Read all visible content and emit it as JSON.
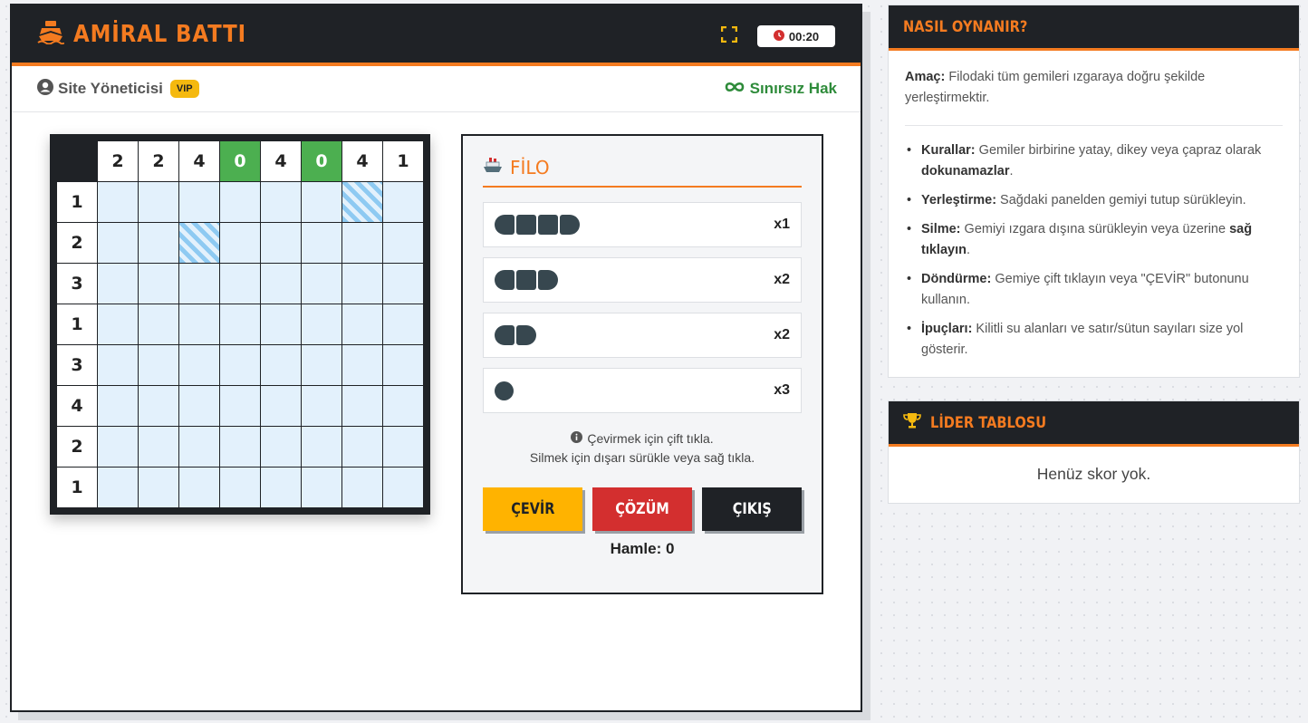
{
  "header": {
    "title": "AMİRAL BATTI",
    "timer": "00:20"
  },
  "user": {
    "name": "Site Yöneticisi",
    "badge": "VIP",
    "rights": "Sınırsız Hak"
  },
  "board": {
    "col_clues": [
      "2",
      "2",
      "4",
      "0",
      "4",
      "0",
      "4",
      "1"
    ],
    "col_done": [
      false,
      false,
      false,
      true,
      false,
      true,
      false,
      false
    ],
    "row_clues": [
      "1",
      "2",
      "3",
      "1",
      "3",
      "4",
      "2",
      "1"
    ],
    "locked_water": [
      [
        0,
        6
      ],
      [
        1,
        2
      ]
    ]
  },
  "fleet": {
    "title": "FİLO",
    "ships": [
      {
        "size": 4,
        "count": "x1"
      },
      {
        "size": 3,
        "count": "x2"
      },
      {
        "size": 2,
        "count": "x2"
      },
      {
        "size": 1,
        "count": "x3"
      }
    ],
    "hint_line1": "Çevirmek için çift tıkla.",
    "hint_line2": "Silmek için dışarı sürükle veya sağ tıkla.",
    "rotate_label": "ÇEVİR",
    "solve_label": "ÇÖZÜM",
    "exit_label": "ÇIKIŞ",
    "moves": "Hamle: 0"
  },
  "howto": {
    "title": "NASIL OYNANIR?",
    "goal_label": "Amaç:",
    "goal_text": " Filodaki tüm gemileri ızgaraya doğru şekilde yerleştirmektir.",
    "rules": [
      {
        "label": "Kurallar:",
        "text": " Gemiler birbirine yatay, dikey veya çapraz olarak ",
        "bold_tail": "dokunamazlar",
        "tail": "."
      },
      {
        "label": "Yerleştirme:",
        "text": " Sağdaki panelden gemiyi tutup sürükleyin.",
        "bold_tail": "",
        "tail": ""
      },
      {
        "label": "Silme:",
        "text": " Gemiyi ızgara dışına sürükleyin veya üzerine ",
        "bold_tail": "sağ tıklayın",
        "tail": "."
      },
      {
        "label": "Döndürme:",
        "text": " Gemiye çift tıklayın veya \"ÇEVİR\" butonunu kullanın.",
        "bold_tail": "",
        "tail": ""
      },
      {
        "label": "İpuçları:",
        "text": " Kilitli su alanları ve satır/sütun sayıları size yol gösterir.",
        "bold_tail": "",
        "tail": ""
      }
    ]
  },
  "leaderboard": {
    "title": "LİDER TABLOSU",
    "empty": "Henüz skor yok."
  },
  "colors": {
    "accent": "#f47b20",
    "dark": "#1f2226",
    "water": "#e3f1fc",
    "done": "#4caf50"
  }
}
